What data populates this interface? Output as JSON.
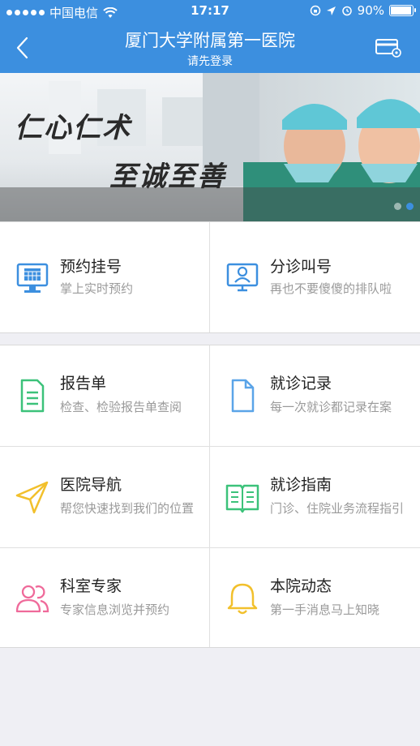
{
  "status_bar": {
    "carrier": "中国电信",
    "time": "17:17",
    "battery": "90%"
  },
  "nav": {
    "title": "厦门大学附属第一医院",
    "subtitle": "请先登录",
    "icons": [
      "back-icon",
      "card-settings-icon"
    ]
  },
  "banner": {
    "slogan_line1": "仁心仁术",
    "slogan_line2": "至诚至善",
    "pages": 2,
    "active_page": 2
  },
  "top_services": [
    {
      "title": "预约挂号",
      "desc": "掌上实时预约",
      "icon": "calendar-monitor-icon",
      "color": "#3c8fdf"
    },
    {
      "title": "分诊叫号",
      "desc": "再也不要傻傻的排队啦",
      "icon": "user-monitor-icon",
      "color": "#3c8fdf"
    }
  ],
  "services": [
    {
      "title": "报告单",
      "desc": "检查、检验报告单查阅",
      "icon": "report-document-icon",
      "color": "#3cc27a"
    },
    {
      "title": "就诊记录",
      "desc": "每一次就诊都记录在案",
      "icon": "file-icon",
      "color": "#5aa4e8"
    },
    {
      "title": "医院导航",
      "desc": "帮您快速找到我们的位置",
      "icon": "paper-plane-icon",
      "color": "#f2c02c"
    },
    {
      "title": "就诊指南",
      "desc": "门诊、住院业务流程指引",
      "icon": "open-book-icon",
      "color": "#3cc27a"
    },
    {
      "title": "科室专家",
      "desc": "专家信息浏览并预约",
      "icon": "experts-icon",
      "color": "#ef6a9a"
    },
    {
      "title": "本院动态",
      "desc": "第一手消息马上知晓",
      "icon": "bell-icon",
      "color": "#f2c02c"
    }
  ]
}
